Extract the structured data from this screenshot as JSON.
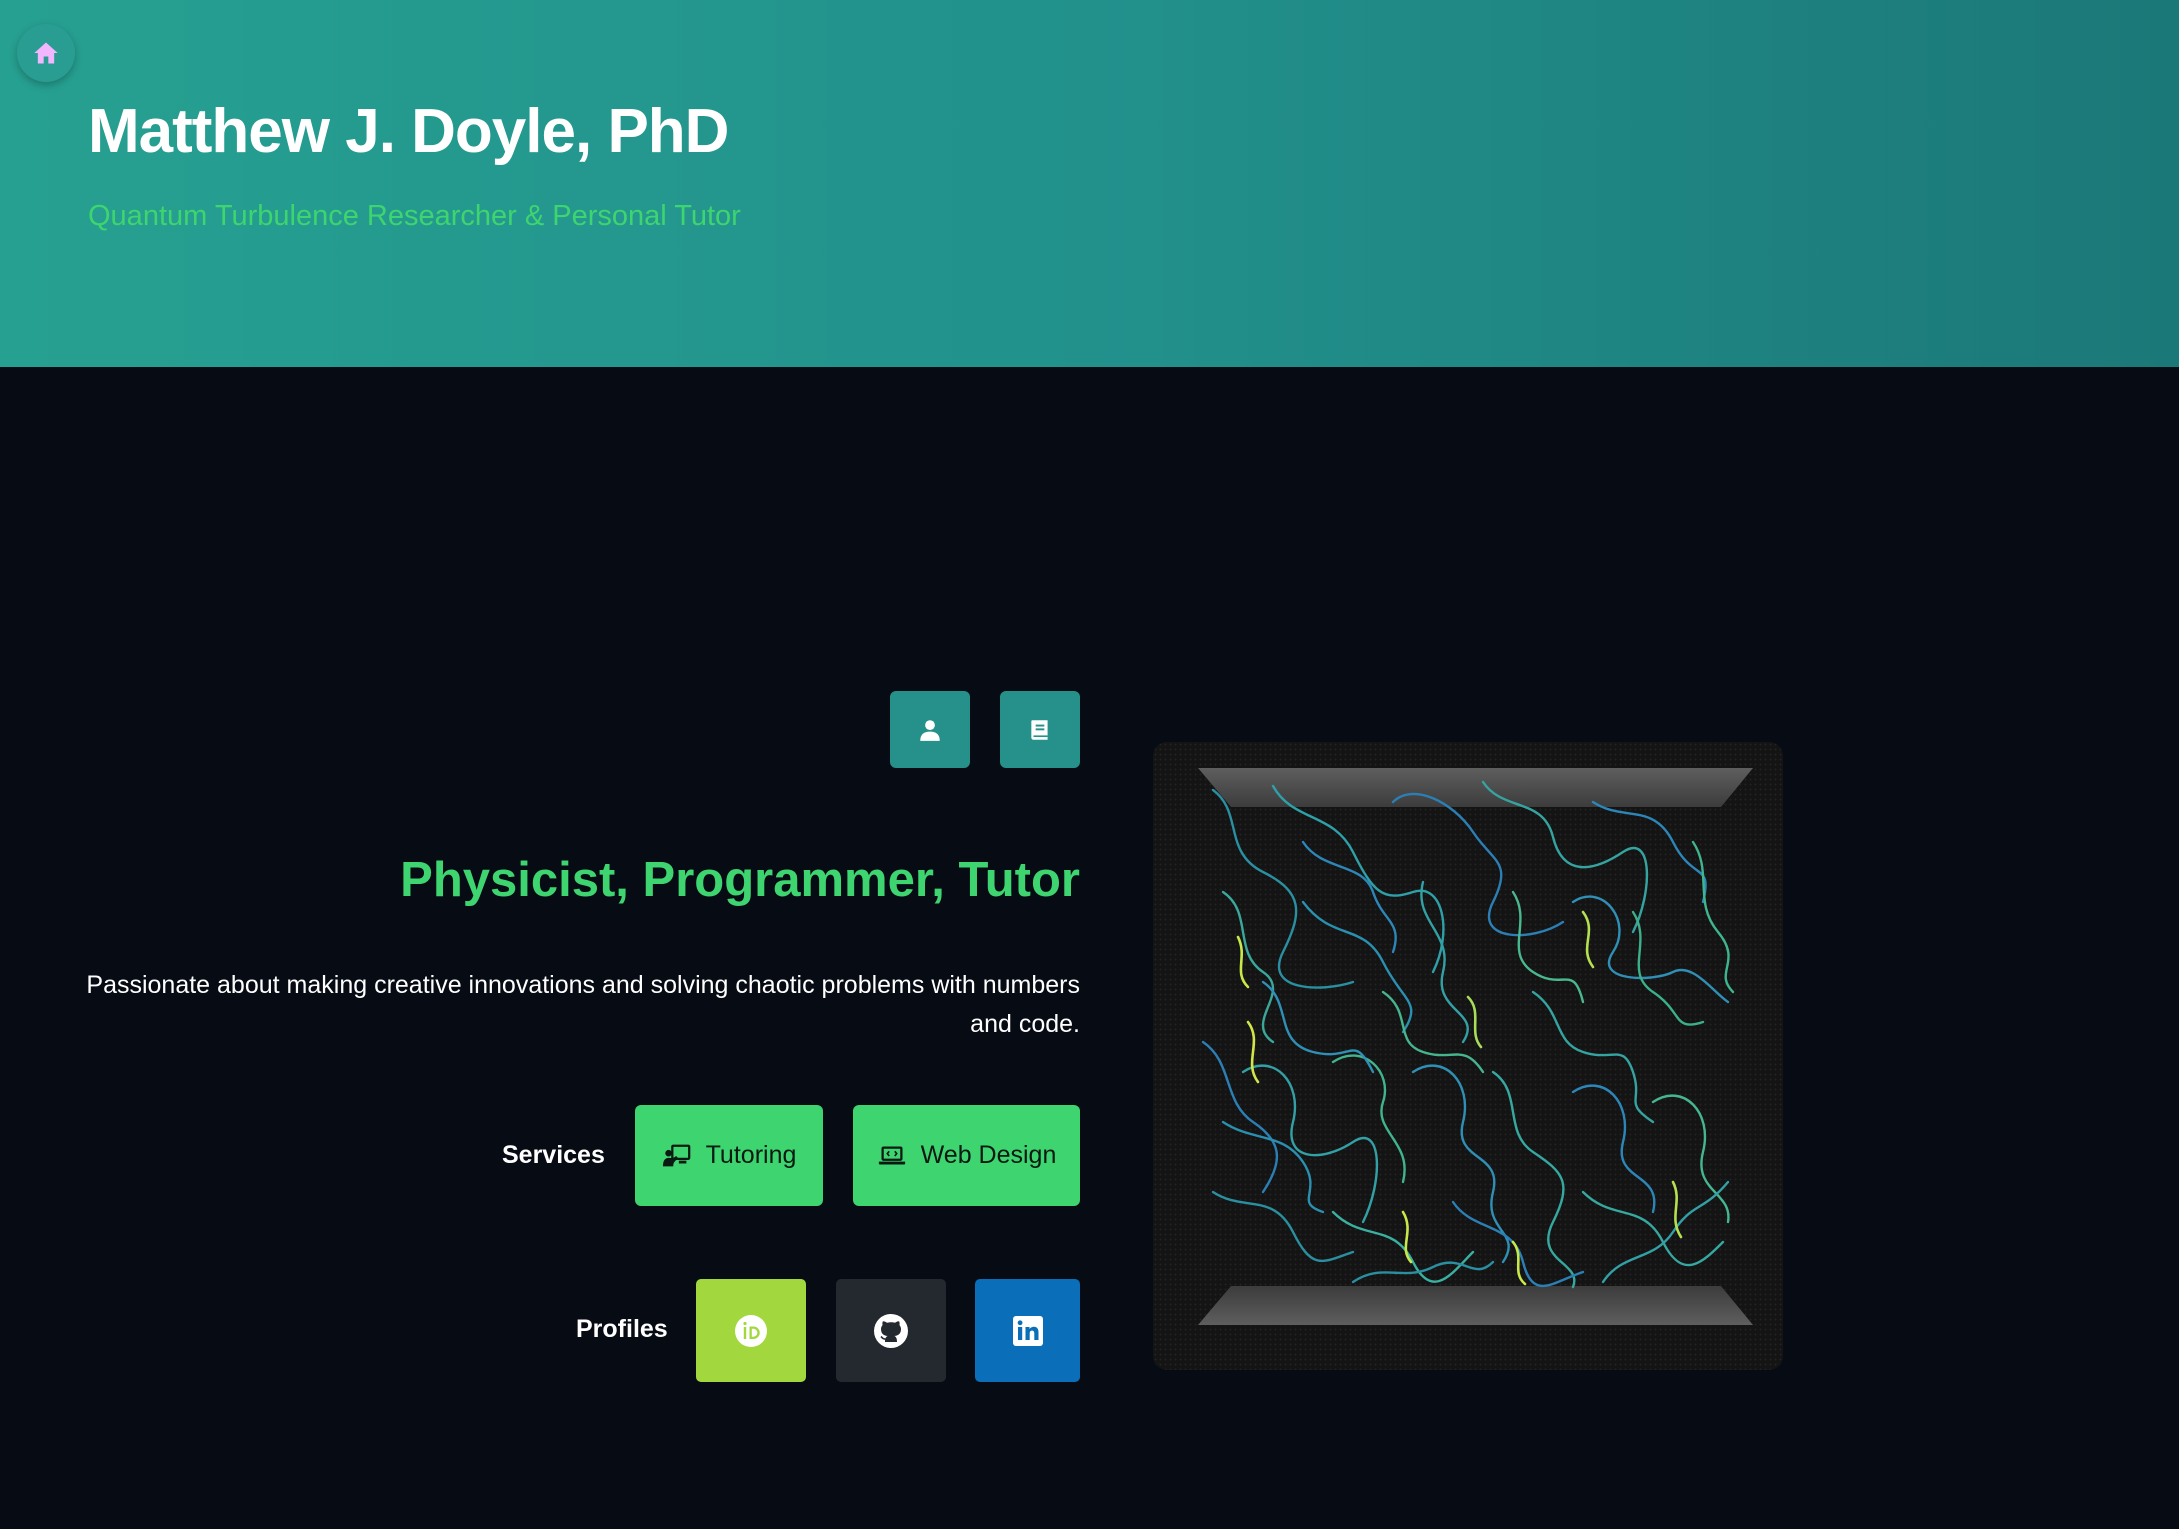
{
  "header": {
    "title": "Matthew J. Doyle, PhD",
    "subtitle": "Quantum Turbulence Researcher & Personal Tutor",
    "home_icon": "home-icon"
  },
  "hero": {
    "tagline": "Physicist, Programmer, Tutor",
    "description": "Passionate about making creative innovations and solving chaotic problems with numbers and code.",
    "icon_buttons": [
      "user-icon",
      "book-icon"
    ]
  },
  "services": {
    "label": "Services",
    "items": [
      {
        "label": "Tutoring",
        "icon": "teacher-icon"
      },
      {
        "label": "Web Design",
        "icon": "laptop-code-icon"
      }
    ]
  },
  "profiles": {
    "label": "Profiles",
    "items": [
      {
        "name": "orcid",
        "icon": "orcid-icon",
        "color": "#a6ce39"
      },
      {
        "name": "github",
        "icon": "github-icon",
        "color": "#24292f"
      },
      {
        "name": "linkedin",
        "icon": "linkedin-icon",
        "color": "#0a66c2"
      }
    ]
  },
  "colors": {
    "header_start": "#26a091",
    "header_end": "#1b7878",
    "accent_green": "#3ed46f",
    "background": "#070b14",
    "icon_button": "#25918a"
  }
}
